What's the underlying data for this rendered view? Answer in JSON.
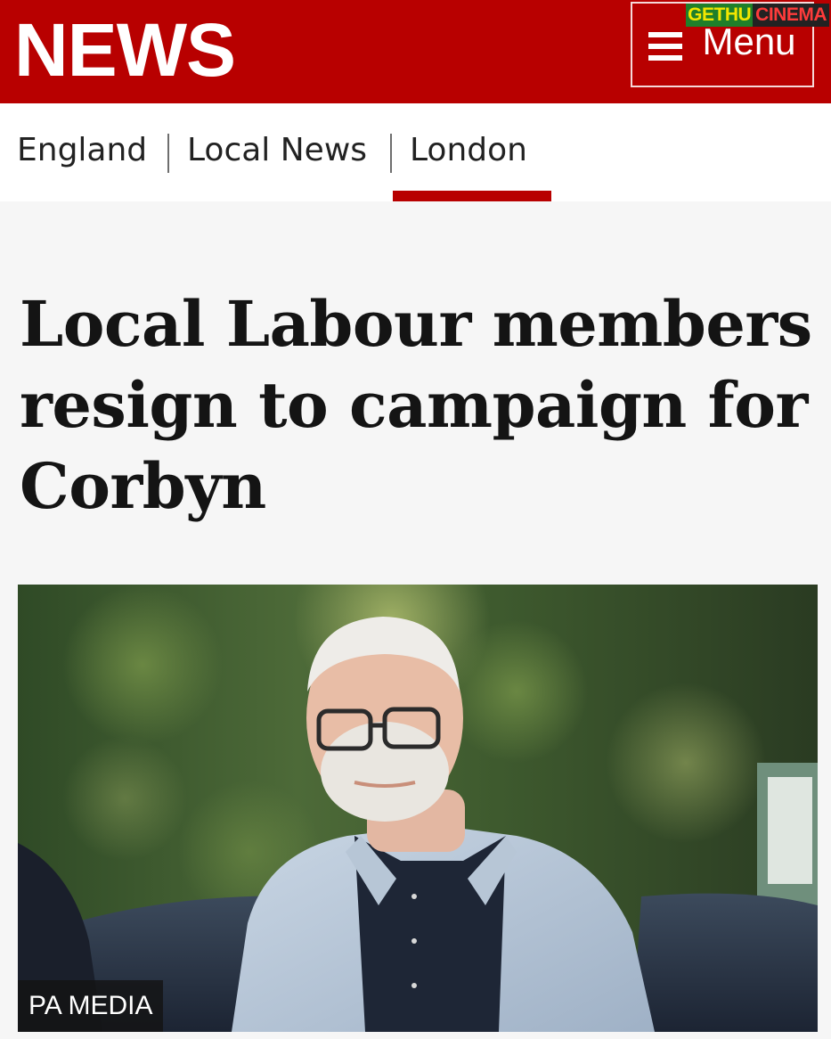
{
  "header": {
    "logo_text": "NEWS",
    "menu_label": "Menu",
    "menu_icon": "hamburger-icon",
    "brand_color": "#b80000"
  },
  "watermark": {
    "part_a": "GETHU",
    "part_b": "CINEMA"
  },
  "breadcrumb": {
    "items": [
      {
        "label": "England"
      },
      {
        "label": "Local News"
      },
      {
        "label": "London",
        "active": true
      }
    ]
  },
  "article": {
    "headline": "Local Labour members resign to campaign for Corbyn",
    "image": {
      "credit": "PA MEDIA",
      "subject": "photo-of-man-with-glasses-in-light-blue-jacket"
    }
  }
}
